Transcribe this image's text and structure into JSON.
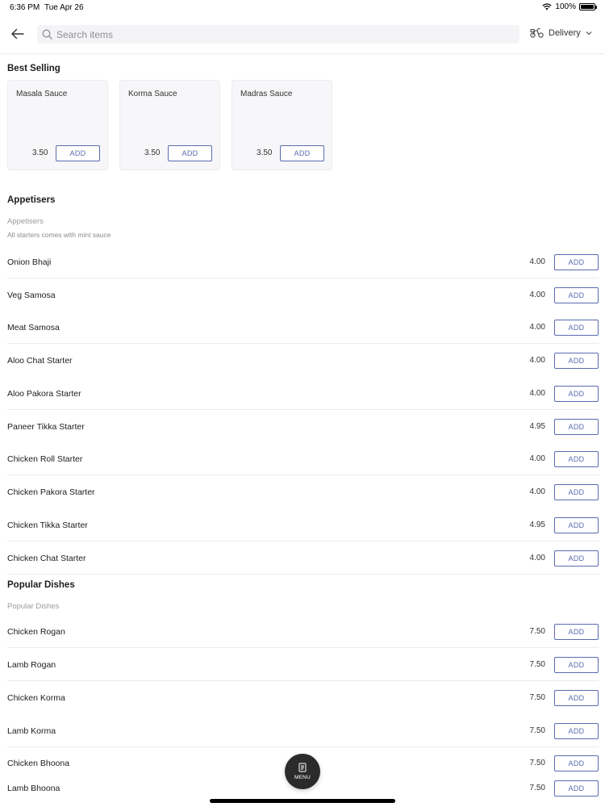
{
  "status_bar": {
    "time": "6:36 PM",
    "date": "Tue Apr 26",
    "battery": "100%"
  },
  "header": {
    "search_placeholder": "Search items",
    "delivery_label": "Delivery"
  },
  "best_selling": {
    "title": "Best Selling",
    "items": [
      {
        "name": "Masala Sauce",
        "price": "3.50",
        "add_label": "ADD"
      },
      {
        "name": "Korma Sauce",
        "price": "3.50",
        "add_label": "ADD"
      },
      {
        "name": "Madras Sauce",
        "price": "3.50",
        "add_label": "ADD"
      }
    ]
  },
  "appetisers": {
    "title": "Appetisers",
    "subheading": "Appetisers",
    "note": "All starters comes with mint sauce",
    "items": [
      {
        "name": "Onion Bhaji",
        "price": "4.00",
        "add_label": "ADD"
      },
      {
        "name": "Veg Samosa",
        "price": "4.00",
        "add_label": "ADD"
      },
      {
        "name": "Meat Samosa",
        "price": "4.00",
        "add_label": "ADD"
      },
      {
        "name": "Aloo Chat Starter",
        "price": "4.00",
        "add_label": "ADD"
      },
      {
        "name": "Aloo Pakora Starter",
        "price": "4.00",
        "add_label": "ADD"
      },
      {
        "name": "Paneer Tikka Starter",
        "price": "4.95",
        "add_label": "ADD"
      },
      {
        "name": "Chicken Roll Starter",
        "price": "4.00",
        "add_label": "ADD"
      },
      {
        "name": "Chicken Pakora Starter",
        "price": "4.00",
        "add_label": "ADD"
      },
      {
        "name": "Chicken Tikka Starter",
        "price": "4.95",
        "add_label": "ADD"
      },
      {
        "name": "Chicken Chat Starter",
        "price": "4.00",
        "add_label": "ADD"
      }
    ]
  },
  "popular_dishes": {
    "title": "Popular Dishes",
    "subheading": "Popular Dishes",
    "items": [
      {
        "name": "Chicken Rogan",
        "price": "7.50",
        "add_label": "ADD"
      },
      {
        "name": "Lamb Rogan",
        "price": "7.50",
        "add_label": "ADD"
      },
      {
        "name": "Chicken Korma",
        "price": "7.50",
        "add_label": "ADD"
      },
      {
        "name": "Lamb Korma",
        "price": "7.50",
        "add_label": "ADD"
      },
      {
        "name": "Chicken Bhoona",
        "price": "7.50",
        "add_label": "ADD"
      },
      {
        "name": "Lamb Bhoona",
        "price": "7.50",
        "add_label": "ADD"
      }
    ]
  },
  "menu_button": {
    "label": "MENU"
  },
  "colors": {
    "accent": "#5a6bb0",
    "separator": "#ececec",
    "card_bg": "#f7f7f9"
  }
}
